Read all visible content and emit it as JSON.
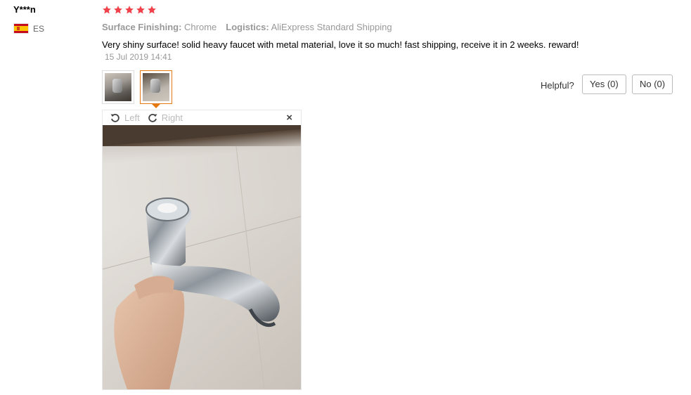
{
  "review": {
    "username": "Y***n",
    "country_code": "ES",
    "rating": 5,
    "star_color": "#f0424c",
    "surface_key": "Surface Finishing:",
    "surface_value": "Chrome",
    "logistics_key": "Logistics:",
    "logistics_value": "AliExpress Standard Shipping",
    "text": "Very shiny surface! solid heavy faucet with metal material, love it so much! fast shipping, receive it in 2 weeks. reward!",
    "date": "15 Jul 2019 14:41"
  },
  "viewer": {
    "rotate_left": "Left",
    "rotate_right": "Right",
    "close": "×"
  },
  "helpful": {
    "label": "Helpful?",
    "yes": "Yes (0)",
    "no": "No (0)"
  }
}
